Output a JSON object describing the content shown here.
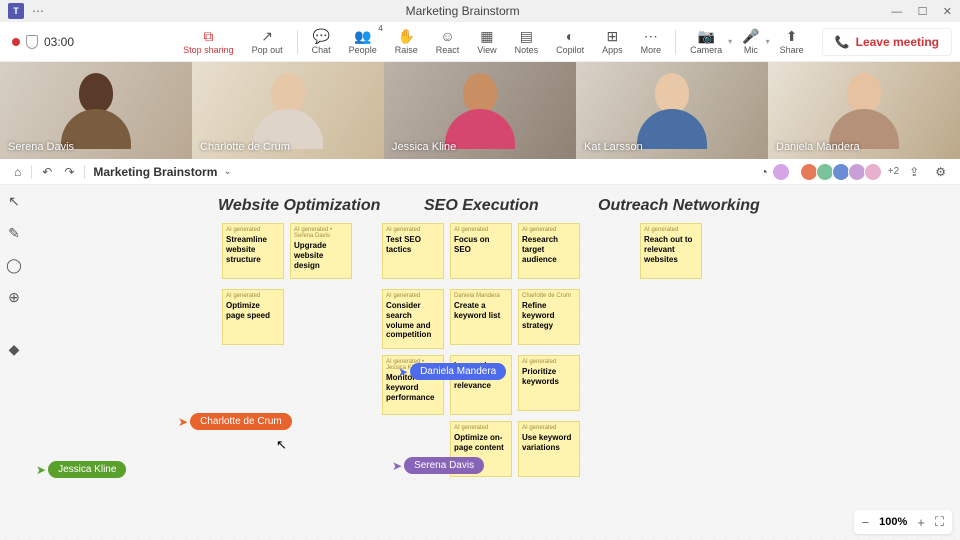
{
  "titlebar": {
    "app": "T",
    "title": "Marketing Brainstorm"
  },
  "recording": {
    "time": "03:00"
  },
  "toolbar": {
    "stop": "Stop sharing",
    "popout": "Pop out",
    "chat": "Chat",
    "people": "People",
    "people_count": "4",
    "raise": "Raise",
    "react": "React",
    "view": "View",
    "notes": "Notes",
    "copilot": "Copilot",
    "apps": "Apps",
    "more": "More",
    "camera": "Camera",
    "mic": "Mic",
    "share": "Share",
    "leave": "Leave meeting"
  },
  "participants": [
    {
      "name": "Serena Davis"
    },
    {
      "name": "Charlotte de Crum"
    },
    {
      "name": "Jessica Kline"
    },
    {
      "name": "Kat Larsson"
    },
    {
      "name": "Daniela Mandera"
    }
  ],
  "whiteboard": {
    "name": "Marketing Brainstorm",
    "more_count": "+2",
    "zoom": "100%"
  },
  "columns": {
    "c1": "Website Optimization",
    "c2": "SEO Execution",
    "c3": "Outreach Networking"
  },
  "notes": {
    "n1": {
      "tag": "AI generated",
      "txt": "Streamline website structure"
    },
    "n2": {
      "tag": "AI generated • Serena Davis",
      "txt": "Upgrade website design"
    },
    "n3": {
      "tag": "AI generated",
      "txt": "Optimize page speed"
    },
    "n4": {
      "tag": "AI generated",
      "txt": "Test SEO tactics"
    },
    "n5": {
      "tag": "AI generated",
      "txt": "Focus on SEO"
    },
    "n6": {
      "tag": "AI generated",
      "txt": "Research target audience"
    },
    "n7": {
      "tag": "AI generated",
      "txt": "Consider search volume and competition"
    },
    "n8": {
      "tag": "Daniela Mandera",
      "txt": "Create a keyword list"
    },
    "n9": {
      "tag": "Charlotte de Crum",
      "txt": "Refine keyword strategy"
    },
    "n10": {
      "tag": "AI generated • Jessica Kline",
      "txt": "Monitor keyword performance"
    },
    "n11": {
      "tag": "",
      "txt": "keywords based on relevance"
    },
    "n12": {
      "tag": "AI generated",
      "txt": "Prioritize keywords"
    },
    "n13": {
      "tag": "AI generated",
      "txt": "Optimize on-page content"
    },
    "n14": {
      "tag": "AI generated",
      "txt": "Use keyword variations"
    },
    "n15": {
      "tag": "AI generated",
      "txt": "Reach out to relevant websites"
    }
  },
  "cursors": {
    "orange": "Charlotte de Crum",
    "green": "Jessica Kline",
    "blue": "Daniela Mandera",
    "purple": "Serena Davis"
  }
}
